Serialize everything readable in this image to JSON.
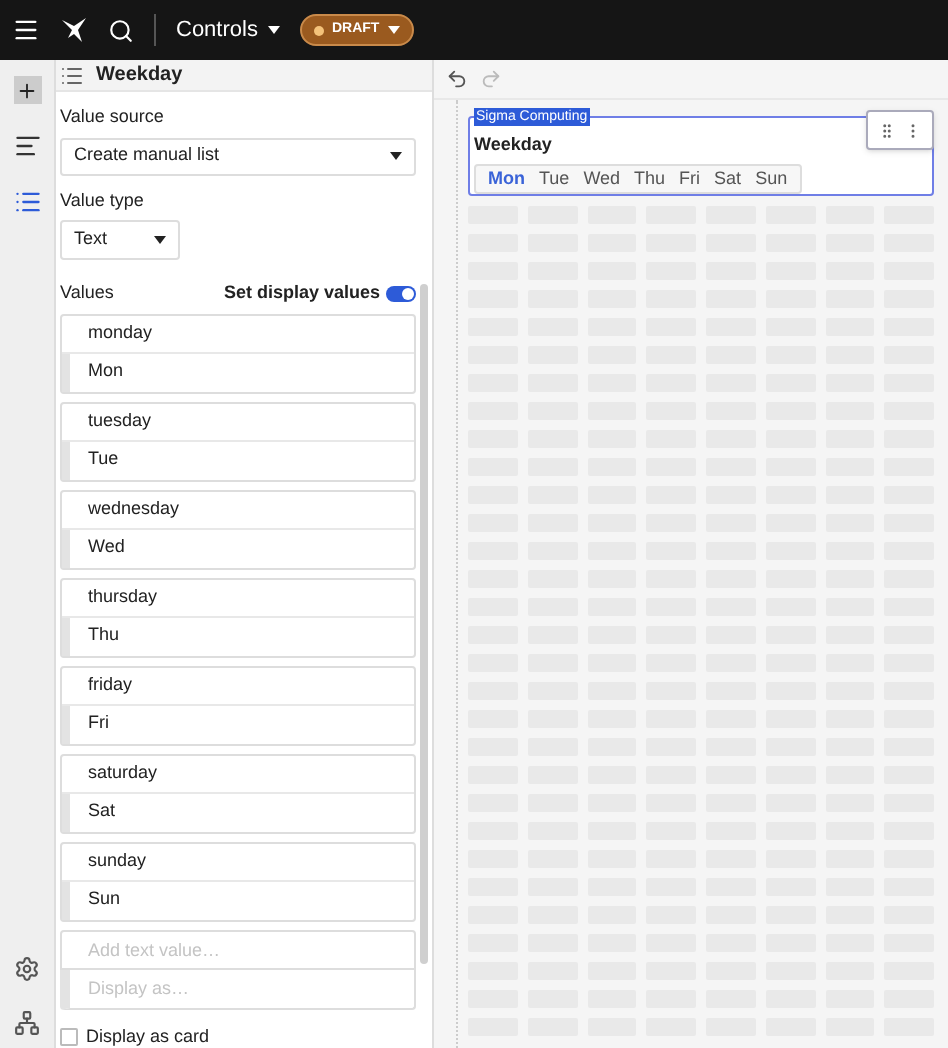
{
  "topbar": {
    "title": "Controls",
    "status": "DRAFT"
  },
  "panel": {
    "title": "Weekday",
    "value_source_label": "Value source",
    "value_source": "Create manual list",
    "value_type_label": "Value type",
    "value_type": "Text",
    "values_label": "Values",
    "display_toggle": {
      "label": "Set display values",
      "on": true
    },
    "values": [
      {
        "value": "monday",
        "display": "Mon"
      },
      {
        "value": "tuesday",
        "display": "Tue"
      },
      {
        "value": "wednesday",
        "display": "Wed"
      },
      {
        "value": "thursday",
        "display": "Thu"
      },
      {
        "value": "friday",
        "display": "Fri"
      },
      {
        "value": "saturday",
        "display": "Sat"
      },
      {
        "value": "sunday",
        "display": "Sun"
      }
    ],
    "new_value": {
      "placeholder": "Add text value…",
      "display_placeholder": "Display as…"
    },
    "display_as_card": {
      "label": "Display as card",
      "checked": false
    }
  },
  "canvas": {
    "element_tag": "Sigma Computing",
    "title": "Weekday",
    "options": [
      {
        "label": "Mon",
        "selected": true
      },
      {
        "label": "Tue",
        "selected": false
      },
      {
        "label": "Wed",
        "selected": false
      },
      {
        "label": "Thu",
        "selected": false
      },
      {
        "label": "Fri",
        "selected": false
      },
      {
        "label": "Sat",
        "selected": false
      },
      {
        "label": "Sun",
        "selected": false
      }
    ]
  }
}
